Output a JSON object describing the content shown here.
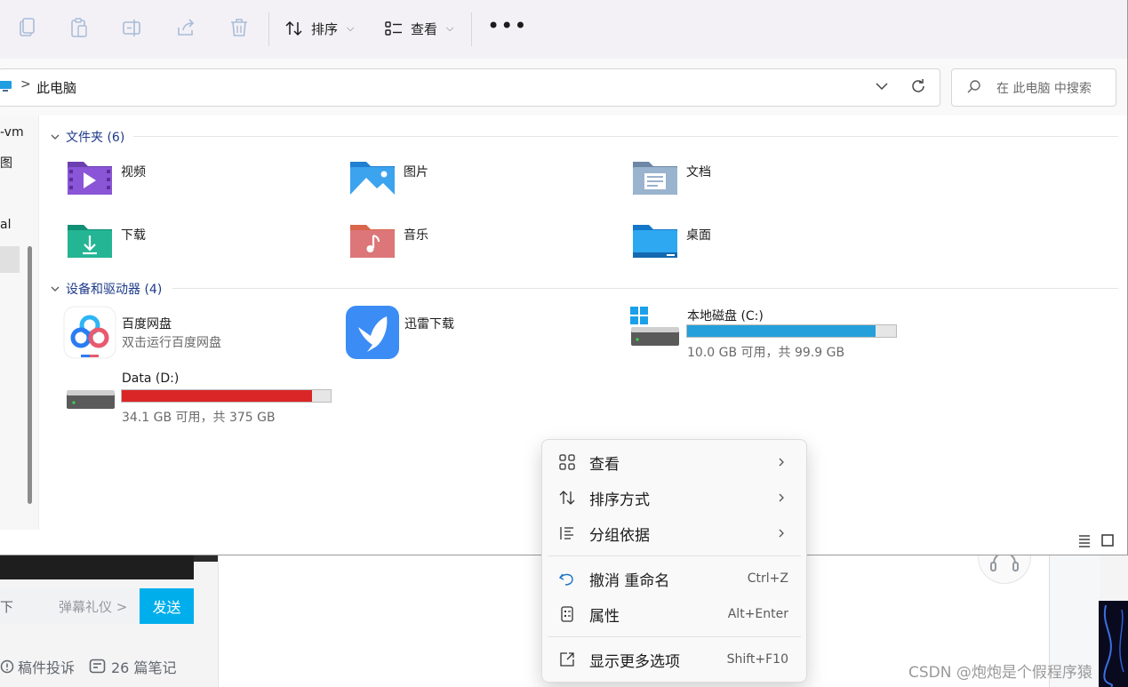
{
  "window": {
    "toolbar": {
      "icons": [
        "copy-icon",
        "paste-icon",
        "rename-icon",
        "share-icon",
        "delete-icon"
      ],
      "sort_label": "排序",
      "view_label": "查看",
      "more_label": "•••"
    },
    "address": {
      "location_icon": "this-pc-icon",
      "separator": ">",
      "path": "此电脑",
      "search_placeholder": "在 此电脑 中搜索"
    },
    "nav_pane": {
      "items": [
        "-vm",
        "图",
        "al"
      ]
    },
    "groups": {
      "folders_header": "文件夹 (6)",
      "devices_header": "设备和驱动器 (4)"
    },
    "folders": [
      {
        "name": "视频",
        "icon": "videos-folder-icon"
      },
      {
        "name": "图片",
        "icon": "pictures-folder-icon"
      },
      {
        "name": "文档",
        "icon": "documents-folder-icon"
      },
      {
        "name": "下载",
        "icon": "downloads-folder-icon"
      },
      {
        "name": "音乐",
        "icon": "music-folder-icon"
      },
      {
        "name": "桌面",
        "icon": "desktop-folder-icon"
      }
    ],
    "devices": [
      {
        "name": "百度网盘",
        "subtitle": "双击运行百度网盘",
        "icon": "baidu-netdisk-icon"
      },
      {
        "name": "迅雷下载",
        "icon": "thunder-download-icon"
      },
      {
        "name": "本地磁盘 (C:)",
        "subtitle": "10.0 GB 可用，共 99.9 GB",
        "icon": "windows-drive-icon",
        "used_fraction": 0.9,
        "bar_color": "#26a0da"
      },
      {
        "name": "Data (D:)",
        "subtitle": "34.1 GB 可用，共 375 GB",
        "icon": "drive-icon",
        "used_fraction": 0.91,
        "bar_color": "#da2626"
      }
    ]
  },
  "context_menu": {
    "items": [
      {
        "label": "查看",
        "icon": "grid-view-icon",
        "submenu": true
      },
      {
        "label": "排序方式",
        "icon": "sort-icon",
        "submenu": true
      },
      {
        "label": "分组依据",
        "icon": "group-by-icon",
        "submenu": true
      },
      {
        "label": "撤消 重命名",
        "icon": "undo-icon",
        "shortcut": "Ctrl+Z"
      },
      {
        "label": "属性",
        "icon": "properties-icon",
        "shortcut": "Alt+Enter"
      },
      {
        "label": "显示更多选项",
        "icon": "more-options-icon",
        "shortcut": "Shift+F10"
      }
    ]
  },
  "background_page": {
    "danmaku_hint": "下",
    "danmaku_gift": "弹幕礼仪 >",
    "send_button": "发送",
    "report": "稿件投诉",
    "notes": "26 篇笔记",
    "watermark": "CSDN @炮炮是个假程序猿"
  }
}
